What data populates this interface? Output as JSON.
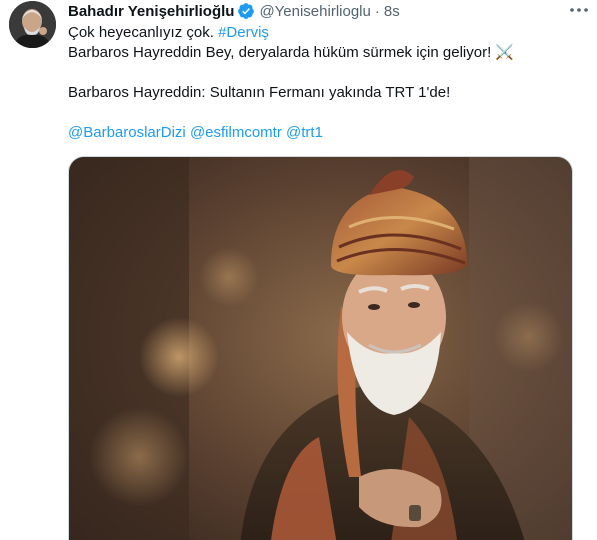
{
  "author": {
    "name": "Bahadır Yenişehirlioğlu",
    "handle": "@Yenisehirlioglu",
    "separator": "·",
    "time": "8s"
  },
  "tweet": {
    "line1_prefix": "Çok heyecanlıyız çok. ",
    "hashtag": "#Derviş",
    "line2": "Barbaros Hayreddin Bey, deryalarda hüküm sürmek için geliyor! ⚔️",
    "line3": "Barbaros Hayreddin: Sultanın Fermanı yakında TRT 1'de!",
    "mentions": [
      "@BarbaroslarDizi",
      "@esfilmcomtr",
      "@trt1"
    ]
  },
  "colors": {
    "link": "#1d9bf0",
    "verified": "#1d9bf0",
    "secondary_text": "#536471"
  },
  "icons": {
    "verified": "verified-badge-icon",
    "more": "more-dots-icon",
    "swords": "crossed-swords-emoji"
  }
}
